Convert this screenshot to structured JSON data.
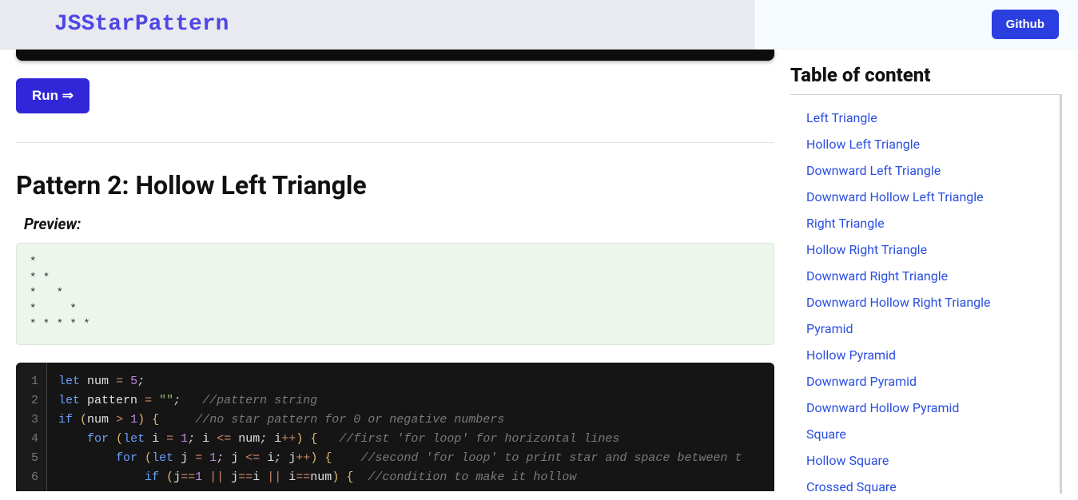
{
  "header": {
    "brand": "JSStarPattern",
    "github_label": "Github"
  },
  "main": {
    "run_label": "Run ⇒",
    "pattern_title": "Pattern 2: Hollow Left Triangle",
    "preview_label": "Preview:",
    "preview_output": "* \n* * \n*   * \n*     * \n* * * * * ",
    "code_lines": [
      "let num = 5;",
      "let pattern = \"\";   //pattern string",
      "if (num > 1) {     //no star pattern for 0 or negative numbers",
      "    for (let i = 1; i <= num; i++) {   //first 'for loop' for horizontal lines",
      "        for (let j = 1; j <= i; j++) {    //second 'for loop' to print star and space between t",
      "            if (j==1 || j==i || i==num) {  //condition to make it hollow"
    ]
  },
  "toc": {
    "title": "Table of content",
    "items": [
      "Left Triangle",
      "Hollow Left Triangle",
      "Downward Left Triangle",
      "Downward Hollow Left Triangle",
      "Right Triangle",
      "Hollow Right Triangle",
      "Downward Right Triangle",
      "Downward Hollow Right Triangle",
      "Pyramid",
      "Hollow Pyramid",
      "Downward Pyramid",
      "Downward Hollow Pyramid",
      "Square",
      "Hollow Square",
      "Crossed Square"
    ]
  }
}
